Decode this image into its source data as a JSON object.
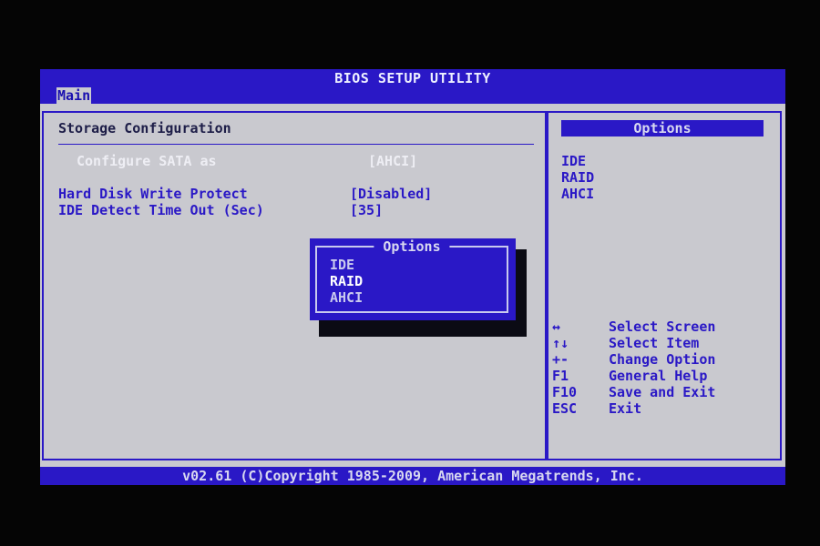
{
  "window": {
    "title": "BIOS SETUP UTILITY"
  },
  "tabs": [
    {
      "label": "Main",
      "selected": true
    }
  ],
  "main": {
    "section_title": "Storage Configuration",
    "items": [
      {
        "label": "Configure SATA as",
        "value": "[AHCI]",
        "enabled": false
      },
      {
        "label": "Hard Disk Write Protect",
        "value": "[Disabled]",
        "enabled": true
      },
      {
        "label": "IDE Detect Time Out (Sec)",
        "value": "[35]",
        "enabled": true
      }
    ]
  },
  "help_panel": {
    "title": "Options",
    "options": [
      "IDE",
      "RAID",
      "AHCI"
    ],
    "keys": [
      {
        "key": "↔",
        "desc": "Select Screen"
      },
      {
        "key": "↑↓",
        "desc": "Select Item"
      },
      {
        "key": "+-",
        "desc": "Change Option"
      },
      {
        "key": "F1",
        "desc": "General Help"
      },
      {
        "key": "F10",
        "desc": "Save and Exit"
      },
      {
        "key": "ESC",
        "desc": "Exit"
      }
    ]
  },
  "popup": {
    "title": "Options",
    "items": [
      "IDE",
      "RAID",
      "AHCI"
    ],
    "selected_index": 1
  },
  "footer": {
    "text": "v02.61 (C)Copyright 1985-2009, American Megatrends, Inc."
  },
  "colors": {
    "bios_blue": "#2a18c6",
    "bios_gray": "#c9c9cf",
    "bezel": "#050505"
  }
}
